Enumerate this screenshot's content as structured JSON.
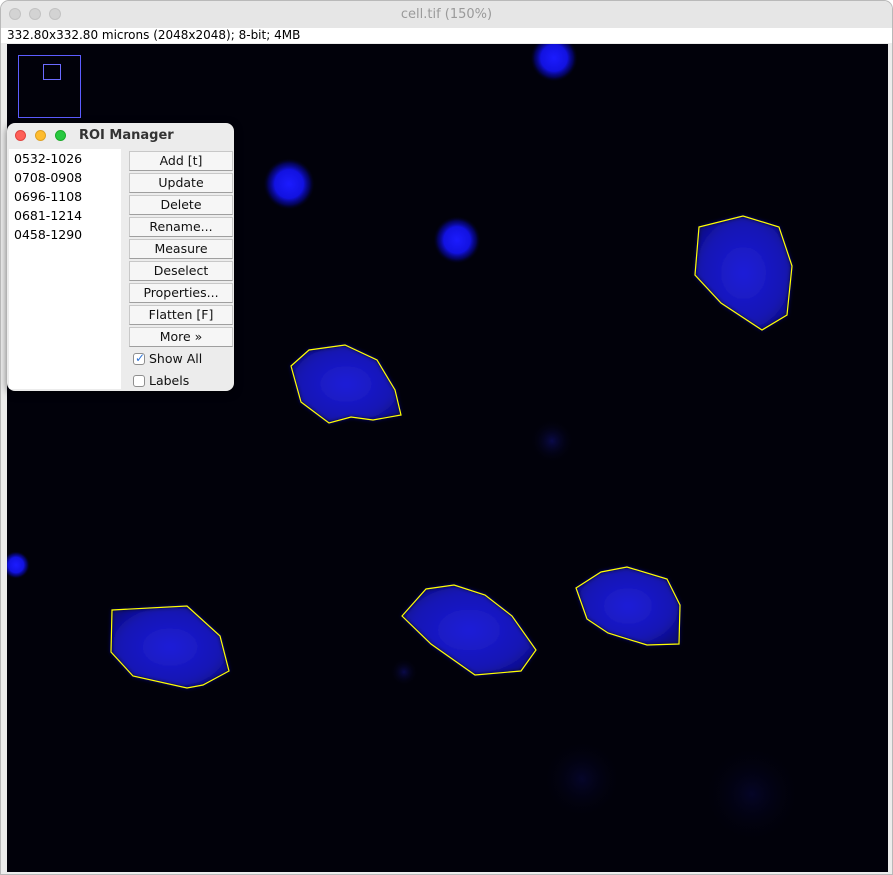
{
  "window": {
    "title": "cell.tif (150%)",
    "info": "332.80x332.80 microns (2048x2048); 8-bit; 4MB"
  },
  "roi_manager": {
    "title": "ROI Manager",
    "items": [
      "0532-1026",
      "0708-0908",
      "0696-1108",
      "0681-1214",
      "0458-1290"
    ],
    "buttons": [
      "Add [t]",
      "Update",
      "Delete",
      "Rename...",
      "Measure",
      "Deselect",
      "Properties...",
      "Flatten [F]",
      "More »"
    ],
    "show_all": {
      "label": "Show All",
      "checked": true
    },
    "labels": {
      "label": "Labels",
      "checked": false
    }
  },
  "colors": {
    "roi_outline": "#ffff00",
    "nucleus": "#1a1aff",
    "background": "#01010a"
  }
}
